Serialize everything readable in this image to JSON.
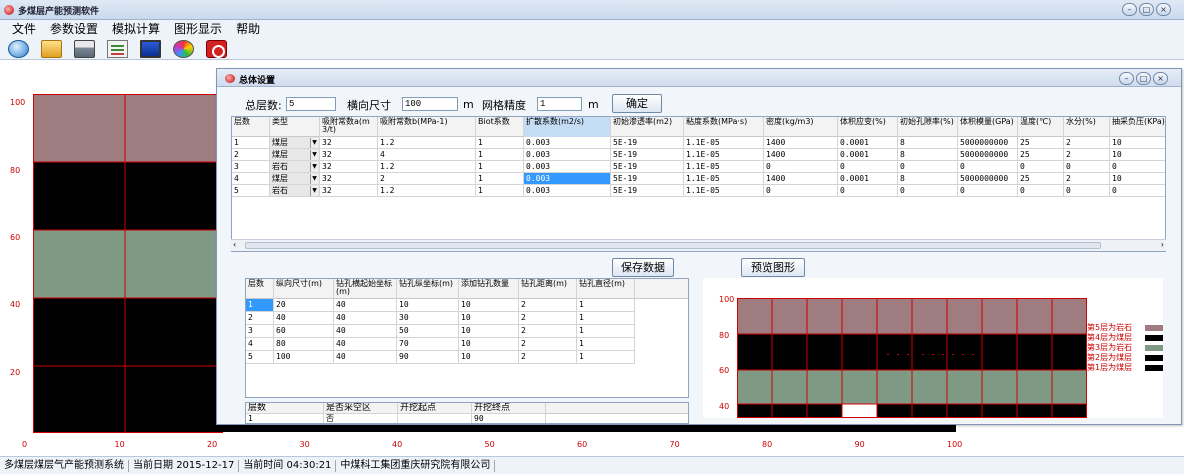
{
  "app": {
    "title": "多煤层产能预测软件"
  },
  "menu": [
    "文件",
    "参数设置",
    "模拟计算",
    "图形显示",
    "帮助"
  ],
  "toolbar_icons": [
    "globe-icon",
    "folder-icon",
    "printer-icon",
    "edit-icon",
    "monitor-icon",
    "palette-icon",
    "power-icon"
  ],
  "main_chart": {
    "y_ticks": [
      "100",
      "80",
      "60",
      "40",
      "20"
    ],
    "x_ticks": [
      "0",
      "10",
      "20",
      "30",
      "40",
      "50",
      "60",
      "70",
      "80",
      "90",
      "100"
    ]
  },
  "dialog": {
    "title": "总体设置",
    "total_layers_label": "总层数:",
    "total_layers_value": "5",
    "transverse_label": "横向尺寸",
    "transverse_value": "100",
    "transverse_unit": "m",
    "mesh_label": "网格精度",
    "mesh_value": "1",
    "mesh_unit": "m",
    "confirm_label": "确定",
    "save_label": "保存数据",
    "preview_label": "预览图形"
  },
  "layer_table": {
    "headers": [
      "层数",
      "类型",
      "吸附常数a(m3/t)",
      "吸附常数b(MPa-1)",
      "Biot系数",
      "扩散系数(m2/s)",
      "初始渗透率(m2)",
      "粘度系数(MPa·s)",
      "密度(kg/m3)",
      "体积应变(%)",
      "初始孔隙率(%)",
      "体积模量(GPa)",
      "温度(℃)",
      "水分(%)",
      "抽采负压(KPa)"
    ],
    "rows": [
      [
        "1",
        "煤层",
        "32",
        "1.2",
        "1",
        "0.003",
        "5E-19",
        "1.1E-05",
        "1400",
        "0.0001",
        "8",
        "5000000000",
        "25",
        "2",
        "10"
      ],
      [
        "2",
        "煤层",
        "32",
        "4",
        "1",
        "0.003",
        "5E-19",
        "1.1E-05",
        "1400",
        "0.0001",
        "8",
        "5000000000",
        "25",
        "2",
        "10"
      ],
      [
        "3",
        "岩石",
        "32",
        "1.2",
        "1",
        "0.003",
        "5E-19",
        "1.1E-05",
        "0",
        "0",
        "0",
        "0",
        "0",
        "0",
        "0"
      ],
      [
        "4",
        "煤层",
        "32",
        "2",
        "1",
        "0.003",
        "5E-19",
        "1.1E-05",
        "1400",
        "0.0001",
        "8",
        "5000000000",
        "25",
        "2",
        "10"
      ],
      [
        "5",
        "岩石",
        "32",
        "1.2",
        "1",
        "0.003",
        "5E-19",
        "1.1E-05",
        "0",
        "0",
        "0",
        "0",
        "0",
        "0",
        "0"
      ]
    ]
  },
  "borehole_table": {
    "headers": [
      "层数",
      "纵向尺寸(m)",
      "钻孔横起始坐标(m)",
      "钻孔纵坐标(m)",
      "添加钻孔数量",
      "钻孔距离(m)",
      "钻孔直径(m)"
    ],
    "rows": [
      [
        "1",
        "20",
        "40",
        "10",
        "10",
        "2",
        "1"
      ],
      [
        "2",
        "40",
        "40",
        "30",
        "10",
        "2",
        "1"
      ],
      [
        "3",
        "60",
        "40",
        "50",
        "10",
        "2",
        "1"
      ],
      [
        "4",
        "80",
        "40",
        "70",
        "10",
        "2",
        "1"
      ],
      [
        "5",
        "100",
        "40",
        "90",
        "10",
        "2",
        "1"
      ]
    ]
  },
  "mining_table": {
    "headers": [
      "层数",
      "是否采空区",
      "开挖起点",
      "开挖终点"
    ],
    "row": [
      "1",
      "否",
      "",
      "90"
    ]
  },
  "preview_chart": {
    "y_ticks": [
      "100",
      "80",
      "60",
      "40"
    ],
    "legend": [
      "第5层为岩石",
      "第4层为煤层",
      "第3层为岩石",
      "第2层为煤层",
      "第1层为煤层"
    ]
  },
  "status": {
    "app": "多煤层煤层气产能预测系统",
    "date_label": "当前日期",
    "date": "2015-12-17",
    "time_label": "当前时间",
    "time": "04:30:21",
    "org": "中煤科工集团重庆研究院有限公司"
  },
  "colors": {
    "rock": "#9e7c7f",
    "coal": "#000000",
    "rock_green": "#7e9a84",
    "grid_line": "#d00000",
    "axis_text": "#cc0000"
  }
}
